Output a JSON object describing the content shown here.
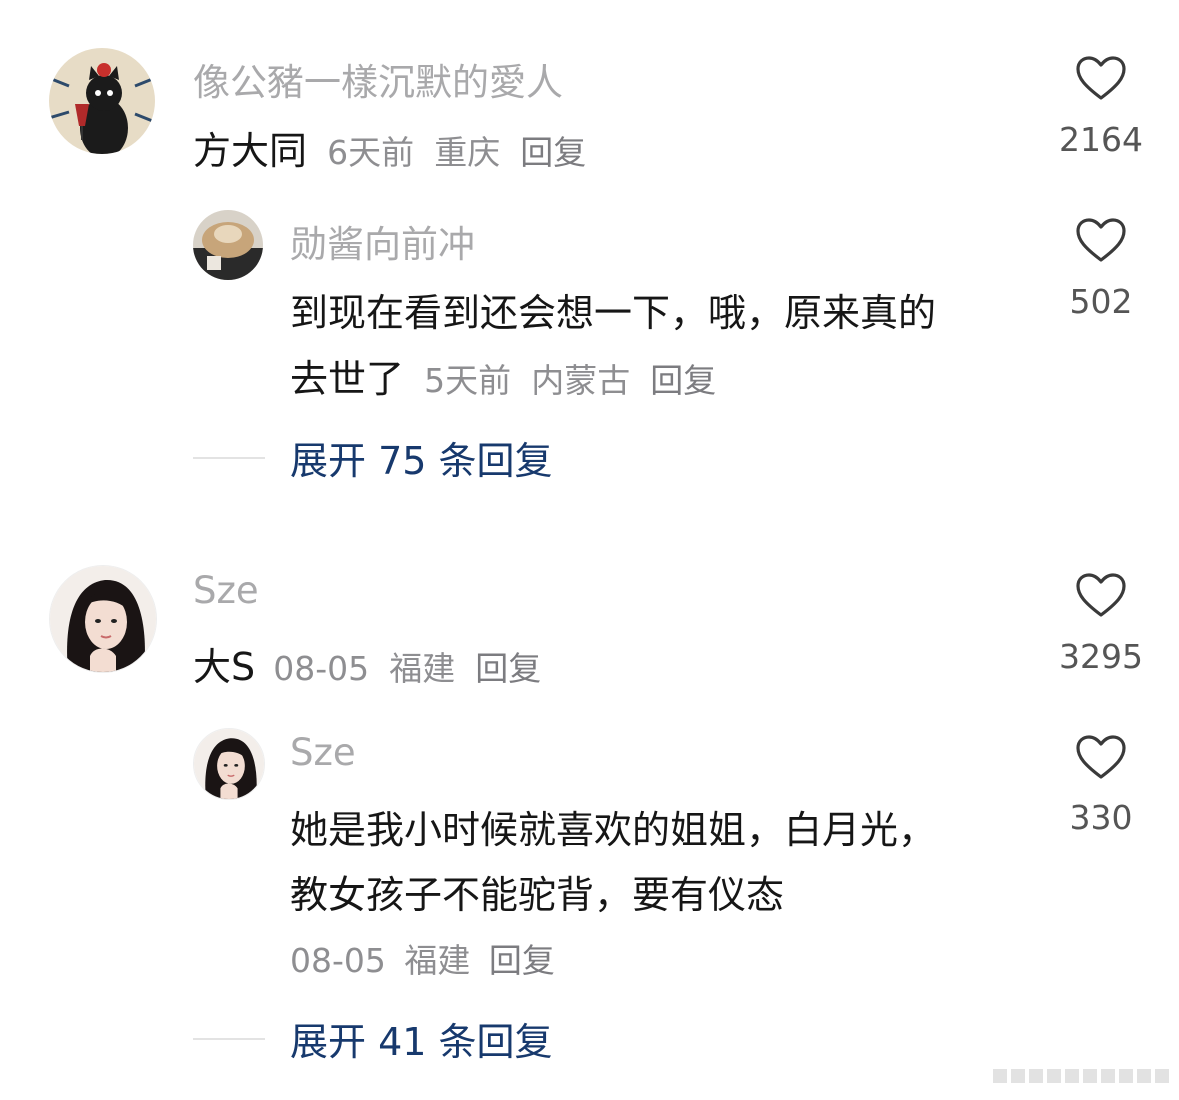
{
  "comments": [
    {
      "username": "像公豬一樣沉默的愛人",
      "text": "方大同",
      "time": "6天前",
      "location": "重庆",
      "reply_label": "回复",
      "likes": "2164",
      "avatar_icon": "cat-avatar-icon",
      "replies": [
        {
          "username": "勋酱向前冲",
          "text_line1": "到现在看到还会想一下，哦，原来真的",
          "text_line2": "去世了",
          "time": "5天前",
          "location": "内蒙古",
          "reply_label": "回复",
          "likes": "502",
          "avatar_icon": "photo-avatar-icon"
        }
      ],
      "expand_label": "展开 75 条回复"
    },
    {
      "username": "Sze",
      "text": "大S",
      "time": "08-05",
      "location": "福建",
      "reply_label": "回复",
      "likes": "3295",
      "avatar_icon": "portrait-avatar-icon",
      "replies": [
        {
          "username": "Sze",
          "text_line1": "她是我小时候就喜欢的姐姐，白月光，",
          "text_line2": "教女孩子不能驼背，要有仪态",
          "time": "08-05",
          "location": "福建",
          "reply_label": "回复",
          "likes": "330",
          "avatar_icon": "portrait-avatar-icon"
        }
      ],
      "expand_label": "展开 41 条回复"
    }
  ],
  "colors": {
    "username": "#a9a9ab",
    "text": "#161616",
    "meta": "#8e8e91",
    "expand": "#17396d"
  }
}
